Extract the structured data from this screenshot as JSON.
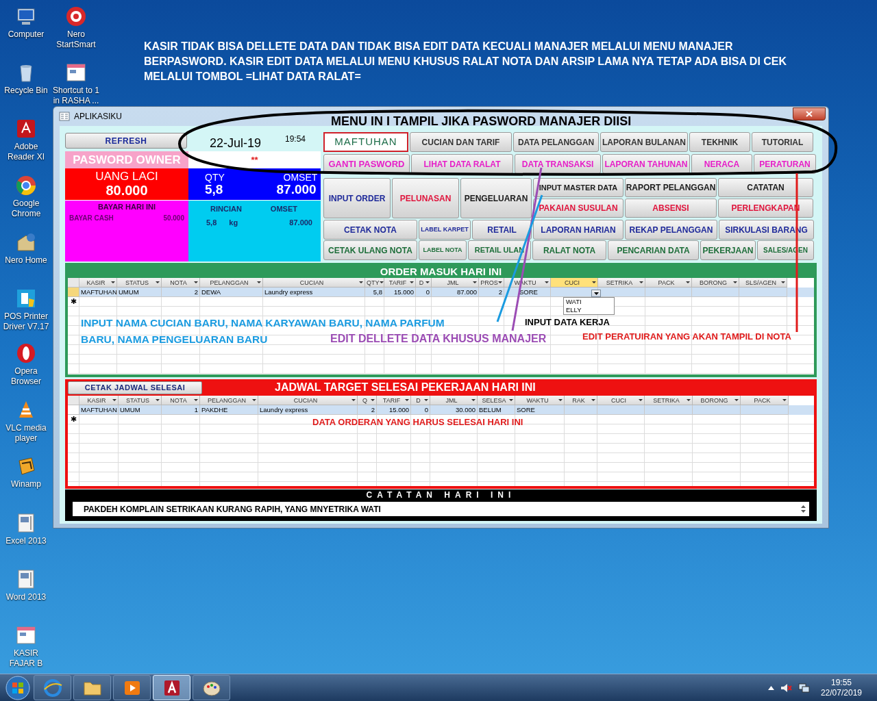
{
  "desktop_icons": [
    {
      "label": "Computer"
    },
    {
      "label": "Nero StartSmart"
    },
    {
      "label": "Recycle Bin"
    },
    {
      "label": "Shortcut to 1 in RASHA ..."
    },
    {
      "label": "Adobe Reader XI"
    },
    {
      "label": "Google Chrome"
    },
    {
      "label": "Nero Home"
    },
    {
      "label": "POS Printer Driver V7.17"
    },
    {
      "label": "Opera Browser"
    },
    {
      "label": "VLC media player"
    },
    {
      "label": "Winamp"
    },
    {
      "label": "Excel 2013"
    },
    {
      "label": "Word 2013"
    },
    {
      "label": "KASIR FAJAR B"
    }
  ],
  "desktop_note": "KASIR TIDAK BISA DELLETE DATA DAN TIDAK BISA EDIT DATA KECUALI MANAJER MELALUI MENU MANAJER BERPASWORD. KASIR EDIT DATA MELALUI MENU KHUSUS RALAT NOTA DAN ARSIP LAMA NYA TETAP ADA BISA DI CEK MELALUI TOMBOL =LIHAT DATA RALAT=",
  "window": {
    "title": "APLIKASIKU"
  },
  "summary": {
    "refresh_button": "REFRESH",
    "date": "22-Jul-19",
    "time": "19:54",
    "password_label": "PASWORD OWNER",
    "password_value": "**",
    "cash_label": "UANG LACI",
    "cash_value": "80.000",
    "qty_label": "QTY",
    "qty_value": "5,8",
    "omset_label": "OMSET",
    "omset_value": "87.000",
    "paid_title": "BAYAR HARI INI",
    "paid_rows": [
      {
        "label": "BAYAR CASH",
        "value": "50.000"
      }
    ],
    "detail_headers": [
      "RINCIAN",
      "OMSET"
    ],
    "detail_rows": [
      {
        "qty": "5,8",
        "unit": "kg",
        "omset": "87.000"
      }
    ]
  },
  "buttons": {
    "row_1": [
      {
        "kind": "label",
        "label": "MAFTUHAN",
        "color": "#1e6e4a"
      },
      {
        "kind": "button",
        "label": "CUCIAN DAN TARIF",
        "color": "#333333"
      },
      {
        "kind": "button",
        "label": "DATA PELANGGAN",
        "color": "#333333"
      },
      {
        "kind": "button",
        "label": "LAPORAN BULANAN",
        "color": "#333333"
      },
      {
        "kind": "button",
        "label": "TEKHNIK",
        "color": "#333333"
      },
      {
        "kind": "button",
        "label": "TUTORIAL",
        "color": "#333333"
      }
    ],
    "row_2": [
      {
        "label": "GANTI PASWORD",
        "color": "#e61fc8"
      },
      {
        "label": "LIHAT DATA RALAT",
        "color": "#e61fc8"
      },
      {
        "label": "DATA TRANSAKSI",
        "color": "#e61fc8"
      },
      {
        "label": "LAPORAN TAHUNAN",
        "color": "#e61fc8"
      },
      {
        "label": "NERACA",
        "color": "#e61fc8"
      },
      {
        "label": "PERATURAN",
        "color": "#e61fc8"
      }
    ],
    "tall": [
      {
        "label": "INPUT ORDER",
        "color": "#1f2a9a"
      },
      {
        "label": "PELUNASAN",
        "color": "#e0143c"
      },
      {
        "label": "PENGELUARAN",
        "color": "#1a1a1a"
      }
    ],
    "stacked": [
      [
        {
          "label": "INPUT MASTER DATA",
          "color": "#1a1a1a"
        },
        {
          "label": "PAKAIAN SUSULAN",
          "color": "#e0143c"
        }
      ],
      [
        {
          "label": "RAPORT PELANGGAN",
          "color": "#1a1a1a"
        },
        {
          "label": "ABSENSI",
          "color": "#e0143c"
        }
      ],
      [
        {
          "label": "CATATAN",
          "color": "#1a1a1a"
        },
        {
          "label": "PERLENGKAPAN",
          "color": "#e0143c"
        }
      ]
    ],
    "row_5": [
      {
        "label": "CETAK NOTA",
        "color": "#1f2a9a"
      },
      {
        "label": "LABEL KARPET",
        "color": "#1f2a9a"
      },
      {
        "label": "RETAIL",
        "color": "#1f2a9a"
      },
      {
        "label": "LAPORAN HARIAN",
        "color": "#1f2a9a"
      },
      {
        "label": "REKAP PELANGGAN",
        "color": "#1f2a9a"
      },
      {
        "label": "SIRKULASI BARANG",
        "color": "#1f2a9a"
      }
    ],
    "row_6": [
      {
        "label": "CETAK ULANG NOTA",
        "color": "#1e6e3a"
      },
      {
        "label": "LABEL NOTA",
        "color": "#1e6e3a"
      },
      {
        "label": "RETAIL ULAN",
        "color": "#1e6e3a"
      },
      {
        "label": "RALAT NOTA",
        "color": "#1e6e3a"
      },
      {
        "label": "PENCARIAN DATA",
        "color": "#1e6e3a"
      },
      {
        "label": "PEKERJAAN",
        "color": "#1e6e3a"
      },
      {
        "label": "SALES/AGEN",
        "color": "#1e6e3a"
      }
    ]
  },
  "order_grid": {
    "title": "ORDER MASUK HARI INI",
    "columns": [
      {
        "label": "KASIR",
        "selected": false
      },
      {
        "label": "STATUS",
        "selected": false
      },
      {
        "label": "NOTA",
        "selected": false
      },
      {
        "label": "PELANGGAN",
        "selected": false
      },
      {
        "label": "CUCIAN",
        "selected": false
      },
      {
        "label": "QTY",
        "selected": false
      },
      {
        "label": "TARIF",
        "selected": false
      },
      {
        "label": "D",
        "selected": false
      },
      {
        "label": "JML",
        "selected": false
      },
      {
        "label": "PROS",
        "selected": false
      },
      {
        "label": "WAKTU",
        "selected": false
      },
      {
        "label": "CUCI",
        "selected": true
      },
      {
        "label": "SETRIKA",
        "selected": false
      },
      {
        "label": "PACK",
        "selected": false
      },
      {
        "label": "BORONG",
        "selected": false
      },
      {
        "label": "SLS/AGEN",
        "selected": false
      }
    ],
    "rows": [
      [
        "MAFTUHAN",
        "UMUM",
        "2",
        "DEWA",
        "Laundry express",
        "5,8",
        "15.000",
        "0",
        "87.000",
        "2",
        "SORE"
      ]
    ],
    "new_row_marker": "✱",
    "dropdown": {
      "options": [
        "WATI",
        "ELLY"
      ]
    }
  },
  "schedule_grid": {
    "print_button": "CETAK JADWAL SELESAI",
    "title": "JADWAL TARGET SELESAI PEKERJAAN HARI INI",
    "columns": [
      {
        "label": "KASIR"
      },
      {
        "label": "STATUS"
      },
      {
        "label": "NOTA"
      },
      {
        "label": "PELANGGAN"
      },
      {
        "label": "CUCIAN"
      },
      {
        "label": "Q"
      },
      {
        "label": "TARIF"
      },
      {
        "label": "D"
      },
      {
        "label": "JML"
      },
      {
        "label": "SELESA"
      },
      {
        "label": "WAKTU"
      },
      {
        "label": "RAK"
      },
      {
        "label": "CUCI"
      },
      {
        "label": "SETRIKA"
      },
      {
        "label": "BORONG"
      },
      {
        "label": "PACK"
      }
    ],
    "rows": [
      [
        "MAFTUHAN",
        "UMUM",
        "1",
        "PAKDHE",
        "Laundry express",
        "2",
        "15.000",
        "0",
        "30.000",
        "BELUM",
        "SORE"
      ]
    ],
    "new_row_marker": "✱"
  },
  "notes": {
    "title": "CATATAN HARI INI",
    "text": "PAKDEH KOMPLAIN SETRIKAAN KURANG RAPIH, YANG MNYETRIKA WATI"
  },
  "annotations": [
    {
      "text": "MENU IN I TAMPIL JIKA PASWORD MANAJER DIISI",
      "color": "#000000"
    },
    {
      "text": "INPUT NAMA CUCIAN BARU, NAMA KARYAWAN BARU, NAMA PARFUM",
      "color": "#1a9be0"
    },
    {
      "text": "BARU, NAMA PENGELUARAN BARU",
      "color": "#1a9be0"
    },
    {
      "text": "INPUT DATA KERJA",
      "color": "#000000"
    },
    {
      "text": "EDIT DELLETE DATA KHUSUS MANAJER",
      "color": "#9b4cb4"
    },
    {
      "text": "EDIT PERATUIRAN YANG AKAN TAMPIL DI NOTA",
      "color": "#e01b1b"
    },
    {
      "text": "DATA ORDERAN YANG HARUS SELESAI HARI INI",
      "color": "#e01b1b"
    }
  ],
  "taskbar": {
    "apps": [
      {
        "selected": false
      },
      {
        "selected": false
      },
      {
        "selected": false
      },
      {
        "selected": true
      },
      {
        "selected": false
      }
    ],
    "clock": {
      "time": "19:55",
      "date": "22/07/2019"
    }
  }
}
